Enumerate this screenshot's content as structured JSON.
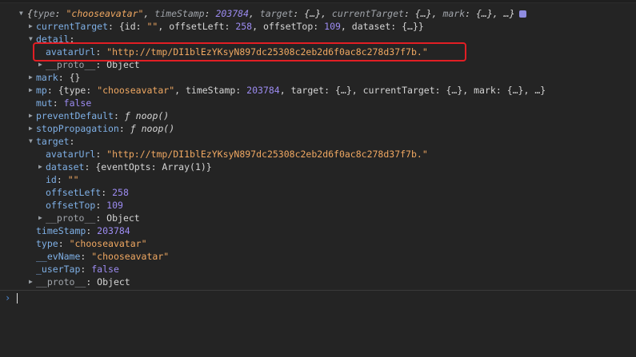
{
  "root": {
    "summary_open": "{",
    "type_key": "type",
    "type_val": "\"chooseavatar\"",
    "ts_key": "timeStamp",
    "ts_val": "203784",
    "target_key": "target",
    "target_val": "{…}",
    "ct_key": "currentTarget",
    "ct_val": "{…}",
    "mark_key": "mark",
    "mark_val": "{…}",
    "summary_close": "…}"
  },
  "currentTarget": {
    "key": "currentTarget",
    "preview_open": "{id: ",
    "id": "\"\"",
    "ol_key": "offsetLeft",
    "ol": "258",
    "ot_key": "offsetTop",
    "ot": "109",
    "ds_key": "dataset",
    "ds": "{…}}"
  },
  "detail": {
    "key": "detail",
    "avatar_key": "avatarUrl",
    "avatar_val": "\"http://tmp/DI1blEzYKsyN897dc25308c2eb2d6f0ac8c278d37f7b.\"",
    "proto_key": "__proto__",
    "proto_val": "Object"
  },
  "mark": {
    "key": "mark",
    "val": "{}"
  },
  "mp": {
    "key": "mp",
    "open": "{type: ",
    "type_val": "\"chooseavatar\"",
    "ts_key": "timeStamp",
    "ts_val": "203784",
    "target_key": "target",
    "target_val": "{…}",
    "ct_key": "currentTarget",
    "ct_val": "{…}",
    "mark_key": "mark",
    "mark_val": "{…}",
    "close": "…}"
  },
  "mut": {
    "key": "mut",
    "val": "false"
  },
  "preventDefault": {
    "key": "preventDefault",
    "f": "ƒ",
    "val": "noop()"
  },
  "stopPropagation": {
    "key": "stopPropagation",
    "f": "ƒ",
    "val": "noop()"
  },
  "target": {
    "key": "target",
    "avatar_key": "avatarUrl",
    "avatar_val": "\"http://tmp/DI1blEzYKsyN897dc25308c2eb2d6f0ac8c278d37f7b.\"",
    "dataset_key": "dataset",
    "dataset_val": "{eventOpts: Array(1)}",
    "id_key": "id",
    "id_val": "\"\"",
    "ol_key": "offsetLeft",
    "ol_val": "258",
    "ot_key": "offsetTop",
    "ot_val": "109",
    "proto_key": "__proto__",
    "proto_val": "Object"
  },
  "timeStamp": {
    "key": "timeStamp",
    "val": "203784"
  },
  "type": {
    "key": "type",
    "val": "\"chooseavatar\""
  },
  "evName": {
    "key": "__evName",
    "val": "\"chooseavatar\""
  },
  "userTap": {
    "key": "_userTap",
    "val": "false"
  },
  "proto": {
    "key": "__proto__",
    "val": "Object"
  },
  "console": {
    "prompt_glyph": "›"
  },
  "colors": {
    "background": "#242424",
    "key": "#7fb0e6",
    "string": "#f0a862",
    "number": "#9d8cf2",
    "highlight": "#e21e24"
  }
}
